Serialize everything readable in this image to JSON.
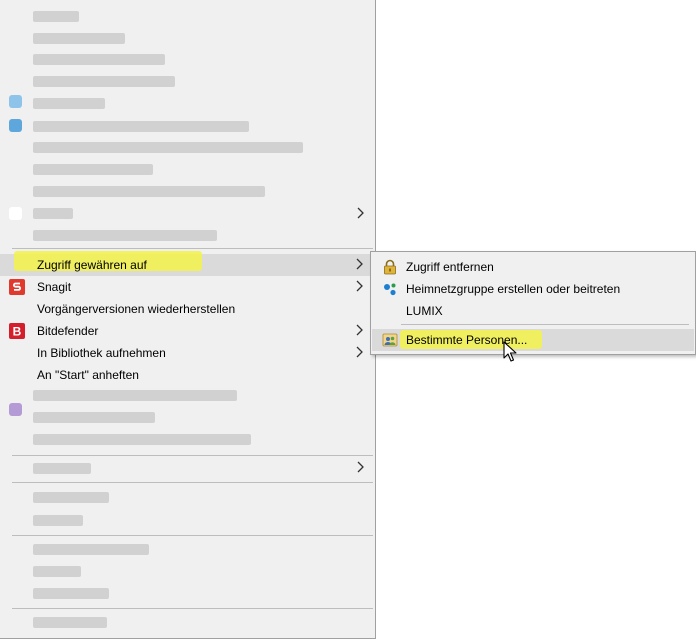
{
  "main_menu": {
    "items": [
      {
        "label": "Zugriff gewähren auf",
        "icon": "none",
        "has_submenu": true,
        "highlighted": true
      },
      {
        "label": "Snagit",
        "icon": "snagit-icon",
        "has_submenu": true
      },
      {
        "label": "Vorgängerversionen wiederherstellen",
        "icon": "none",
        "has_submenu": false
      },
      {
        "label": "Bitdefender",
        "icon": "bitdefender-icon",
        "has_submenu": true
      },
      {
        "label": "In Bibliothek aufnehmen",
        "icon": "none",
        "has_submenu": true
      },
      {
        "label": "An \"Start\" anheften",
        "icon": "none",
        "has_submenu": false
      }
    ],
    "blurred_note": "pixelated items not legible"
  },
  "submenu": {
    "items": [
      {
        "label": "Zugriff entfernen",
        "icon": "lock-icon"
      },
      {
        "label": "Heimnetzgruppe erstellen oder beitreten",
        "icon": "homegroup-icon"
      },
      {
        "label": "LUMIX",
        "icon": "none"
      },
      {
        "label": "Bestimmte Personen...",
        "icon": "people-icon",
        "highlighted": true
      }
    ]
  },
  "colors": {
    "menu_bg": "#f0f0f0",
    "hover_bg": "#dadada",
    "highlighter": "#f2f24a",
    "snagit_red": "#e03a2f",
    "bitdefender_red": "#d41e2c"
  }
}
